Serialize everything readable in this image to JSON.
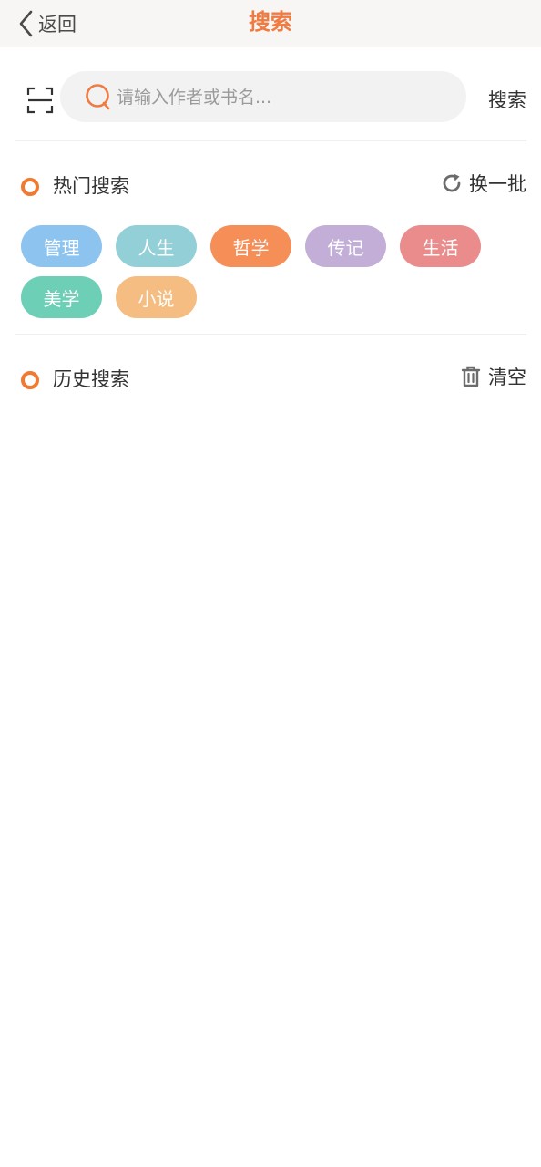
{
  "header": {
    "back_label": "返回",
    "title": "搜索"
  },
  "search": {
    "placeholder": "请输入作者或书名...",
    "value": "",
    "button_label": "搜索"
  },
  "hot": {
    "title": "热门搜索",
    "action_label": "换一批",
    "tags": [
      {
        "label": "管理",
        "color": "#8dc3ef"
      },
      {
        "label": "人生",
        "color": "#93cfd7"
      },
      {
        "label": "哲学",
        "color": "#f58e57"
      },
      {
        "label": "传记",
        "color": "#c2aed6"
      },
      {
        "label": "生活",
        "color": "#ea8c8c"
      },
      {
        "label": "美学",
        "color": "#6ccfb6"
      },
      {
        "label": "小说",
        "color": "#f5bd82"
      }
    ]
  },
  "history": {
    "title": "历史搜索",
    "action_label": "清空",
    "items": []
  },
  "colors": {
    "accent": "#f07a3f",
    "dot": "#f07a2f"
  },
  "icons": {
    "back": "chevron-left-icon",
    "scan": "scan-icon",
    "search": "search-icon",
    "refresh": "refresh-icon",
    "trash": "trash-icon"
  }
}
